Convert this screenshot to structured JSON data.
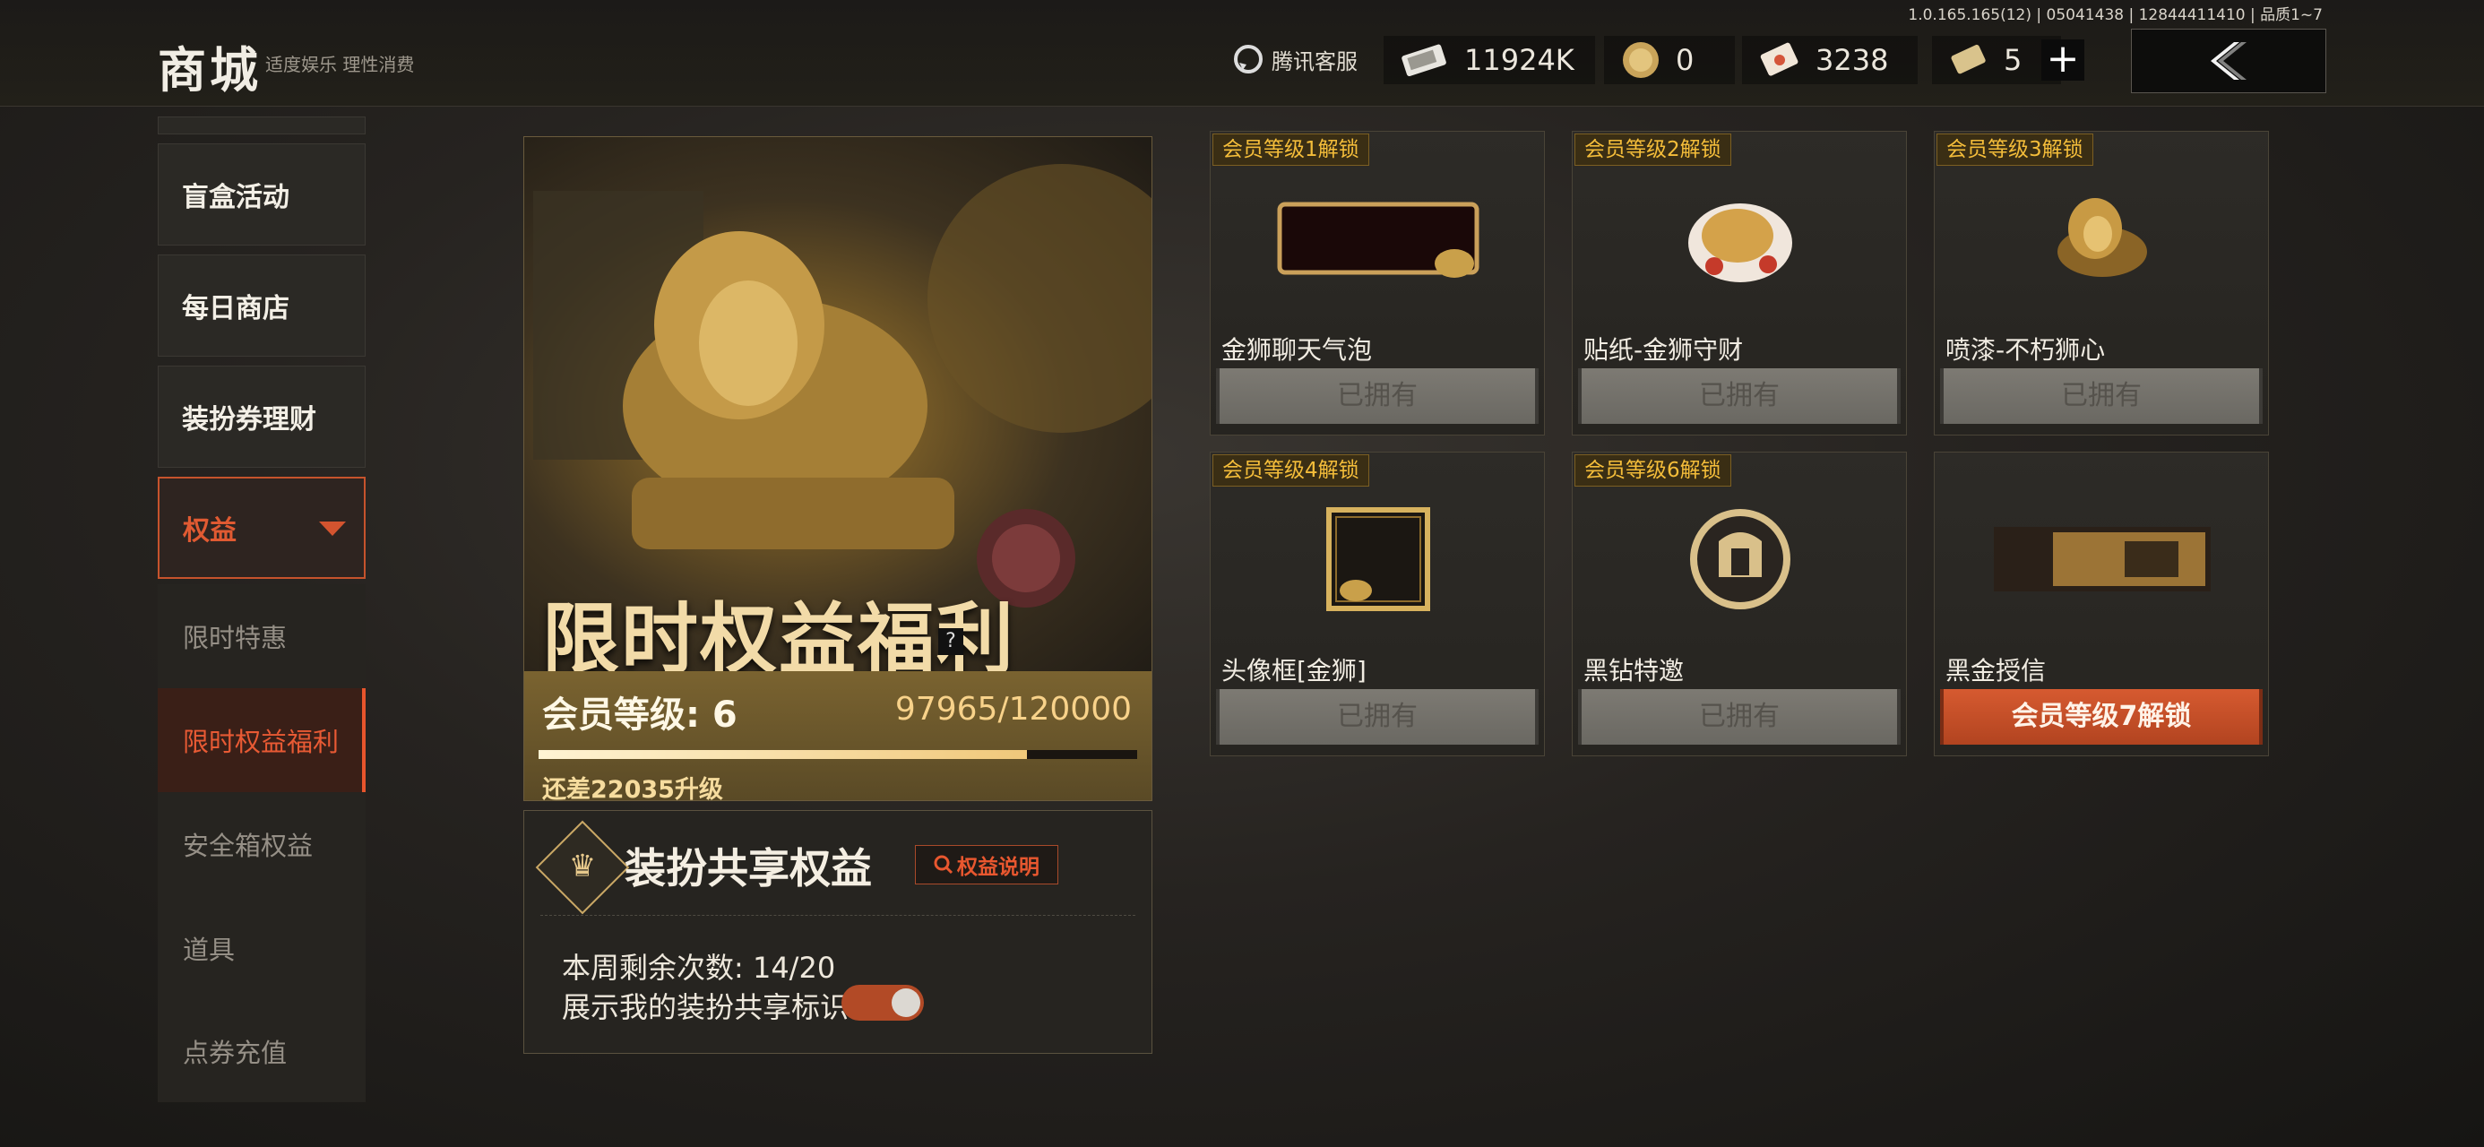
{
  "header": {
    "title": "商城",
    "subtitle": "适度娱乐 理性消费",
    "version": "1.0.165.165(12) | 05041438 | 12844411410 | 品质1~7",
    "customer_service": "腾讯客服",
    "currencies": [
      {
        "icon": "cash-bundle-icon",
        "value": "11924K"
      },
      {
        "icon": "gold-coin-icon",
        "value": "0"
      },
      {
        "icon": "voucher-icon",
        "value": "3238"
      },
      {
        "icon": "ticket-icon",
        "value": "5"
      }
    ],
    "plus": "+"
  },
  "sidebar": {
    "items": [
      {
        "label": "盲盒活动"
      },
      {
        "label": "每日商店"
      },
      {
        "label": "装扮券理财"
      },
      {
        "label": "权益"
      }
    ],
    "sub_items": [
      {
        "label": "限时特惠"
      },
      {
        "label": "限时权益福利"
      },
      {
        "label": "安全箱权益"
      },
      {
        "label": "道具"
      },
      {
        "label": "点券充值"
      }
    ]
  },
  "hero": {
    "banner": "限时权益福利",
    "help": "?",
    "level_label": "会员等级: 6",
    "exp": "97965/120000",
    "progress": 0.816,
    "need": "还差22035升级"
  },
  "share": {
    "title": "装扮共享权益",
    "button": "权益说明",
    "weekly": "本周剩余次数: 14/20",
    "show_tag": "展示我的装扮共享标识",
    "toggle_on": true
  },
  "cards": [
    {
      "tag": "会员等级1解锁",
      "name": "金狮聊天气泡",
      "status": "已拥有",
      "icon": "chat-bubble-icon"
    },
    {
      "tag": "会员等级2解锁",
      "name": "贴纸-金狮守财",
      "status": "已拥有",
      "icon": "sticker-icon"
    },
    {
      "tag": "会员等级3解锁",
      "name": "喷漆-不朽狮心",
      "status": "已拥有",
      "icon": "spray-icon"
    },
    {
      "tag": "会员等级4解锁",
      "name": "头像框[金狮]",
      "status": "已拥有",
      "icon": "avatar-frame-icon"
    },
    {
      "tag": "会员等级6解锁",
      "name": "黑钻特邀",
      "status": "已拥有",
      "icon": "helmet-badge-icon"
    },
    {
      "tag": "",
      "name": "黑金授信",
      "status": "会员等级7解锁",
      "icon": "credit-card-icon"
    }
  ]
}
